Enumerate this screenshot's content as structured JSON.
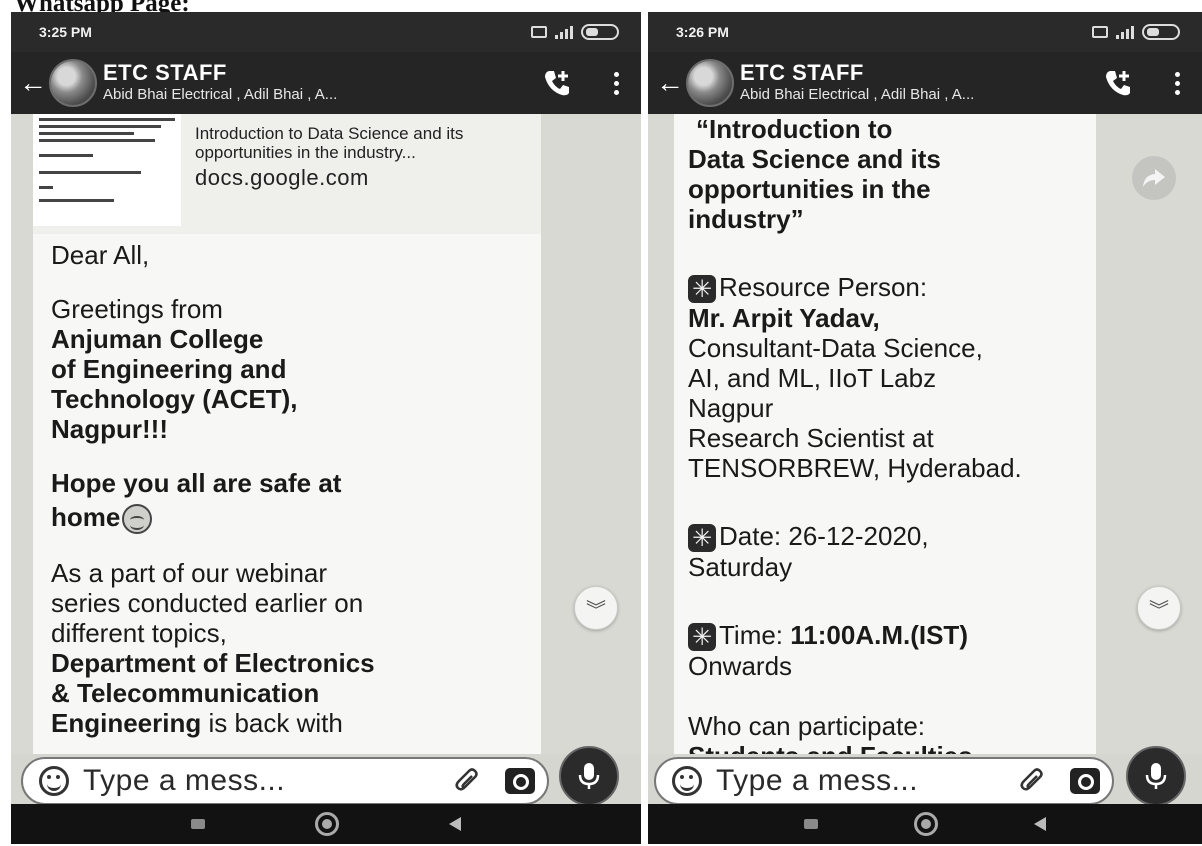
{
  "page_heading": "Whatsapp Page:",
  "colors": {
    "header_bg": "#252525",
    "chat_bg": "#d9d9d4",
    "bubble_bg": "#f7f7f5",
    "nav_bar": "#121212"
  },
  "left_screen": {
    "status_time": "3:25 PM",
    "group_name": "ETC  STAFF",
    "members": "Abid Bhai Electrical , Adil Bhai , A...",
    "link_preview": {
      "title": "Introduction to Data Science and its opportunities in the industry...",
      "domain": "docs.google.com"
    },
    "message": {
      "greeting": "Dear All,",
      "line1": "Greetings from",
      "college": [
        "Anjuman College",
        "of Engineering and",
        "Technology (ACET),",
        "Nagpur!!!"
      ],
      "hope": [
        "Hope you all are safe at",
        "home"
      ],
      "body": [
        "As a part of our webinar",
        "series conducted earlier on",
        "different topics,"
      ],
      "dept": [
        "Department of Electronics",
        "& Telecommunication"
      ],
      "cut_bold": "Engineering",
      "cut_rest": " is back with"
    },
    "input_placeholder": "Type a mess...",
    "icons": [
      "back-arrow",
      "group-avatar",
      "add-call",
      "more-vert",
      "scroll-down",
      "emoji",
      "attach-clip",
      "camera",
      "microphone",
      "nav-recents",
      "nav-home",
      "nav-back"
    ]
  },
  "right_screen": {
    "status_time": "3:26 PM",
    "group_name": "ETC  STAFF",
    "members": "Abid Bhai Electrical , Adil Bhai , A...",
    "message": {
      "title_lines": [
        "“Introduction to",
        "Data Science and its",
        "opportunities in the",
        "industry”"
      ],
      "resource_label": "Resource Person:",
      "person": "Mr. Arpit Yadav,",
      "person_details": [
        "Consultant-Data Science,",
        "AI, and ML, IIoT Labz",
        "Nagpur",
        "Research Scientist at",
        "TENSORBREW, Hyderabad."
      ],
      "date_text": "Date: 26-12-2020,",
      "date_day": "Saturday",
      "time_label": "Time: ",
      "time_value": "11:00A.M.(IST)",
      "time_suffix": "Onwards",
      "who_label": "Who can participate:",
      "cut_line": "Students and Faculties"
    },
    "input_placeholder": "Type a mess...",
    "icons": [
      "back-arrow",
      "group-avatar",
      "add-call",
      "more-vert",
      "share-forward",
      "scroll-down",
      "emoji",
      "attach-clip",
      "camera",
      "microphone",
      "nav-recents",
      "nav-home",
      "nav-back"
    ]
  }
}
